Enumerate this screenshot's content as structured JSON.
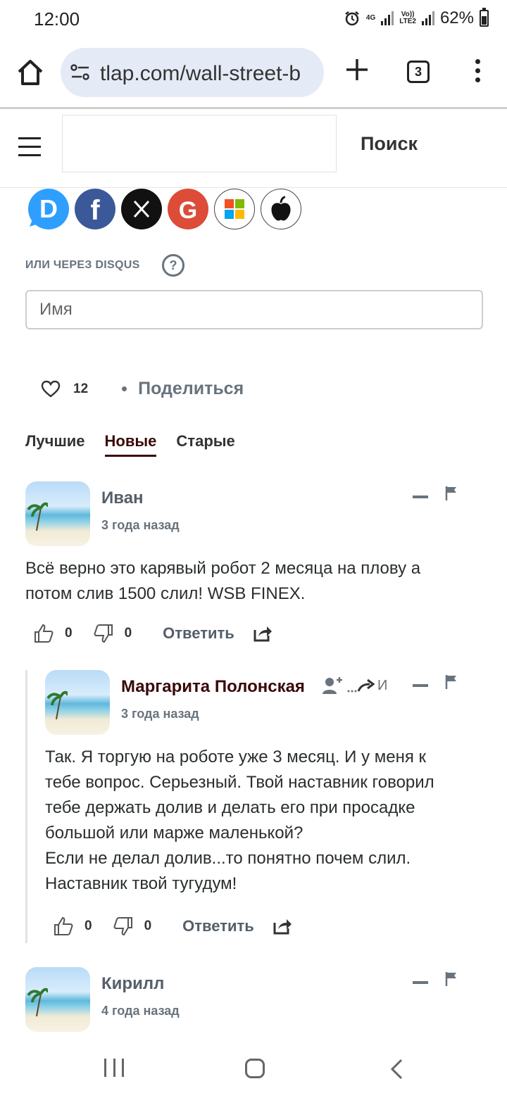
{
  "status_bar": {
    "time": "12:00",
    "network_1": "4G",
    "network_2_top": "Vo))",
    "network_2_bottom": "LTE2",
    "battery": "62%"
  },
  "browser": {
    "url": "tlap.com/wall-street-b",
    "tab_count": "3"
  },
  "site_header": {
    "search_label": "Поиск"
  },
  "login": {
    "providers": [
      "disqus-icon",
      "facebook-icon",
      "x-icon",
      "google-icon",
      "microsoft-icon",
      "apple-icon"
    ],
    "or_label": "ИЛИ ЧЕРЕЗ DISQUS",
    "help_label": "?",
    "name_placeholder": "Имя"
  },
  "reactions": {
    "likes": "12",
    "share_label": "Поделиться"
  },
  "sort_tabs": [
    {
      "label": "Лучшие",
      "active": false
    },
    {
      "label": "Новые",
      "active": true
    },
    {
      "label": "Старые",
      "active": false
    }
  ],
  "comments": [
    {
      "author": "Иван",
      "time": "3 года назад",
      "text_lines": [
        "Всё верно это карявый робот 2 месяца на плову а",
        "потом слив 1500 слил! WSB FINEX."
      ],
      "upvotes": "0",
      "downvotes": "0",
      "reply_label": "Ответить"
    },
    {
      "author": "Маргарита Полонская",
      "reply_to": "И",
      "time": "3 года назад",
      "text_lines": [
        "Так. Я торгую на роботе уже 3 месяц. И у меня к",
        "тебе вопрос. Серьезный. Твой наставник говорил",
        "тебе держать долив и делать его при просадке",
        "большой или марже маленькой?",
        "Если не делал долив...то понятно почем слил.",
        "Наставник твой тугудум!"
      ],
      "upvotes": "0",
      "downvotes": "0",
      "reply_label": "Ответить"
    },
    {
      "author": "Кирилл",
      "time": "4 года назад"
    }
  ],
  "colors": {
    "accent_dark": "#3a0808",
    "muted": "#68737d",
    "url_pill": "#e4ebf6"
  }
}
